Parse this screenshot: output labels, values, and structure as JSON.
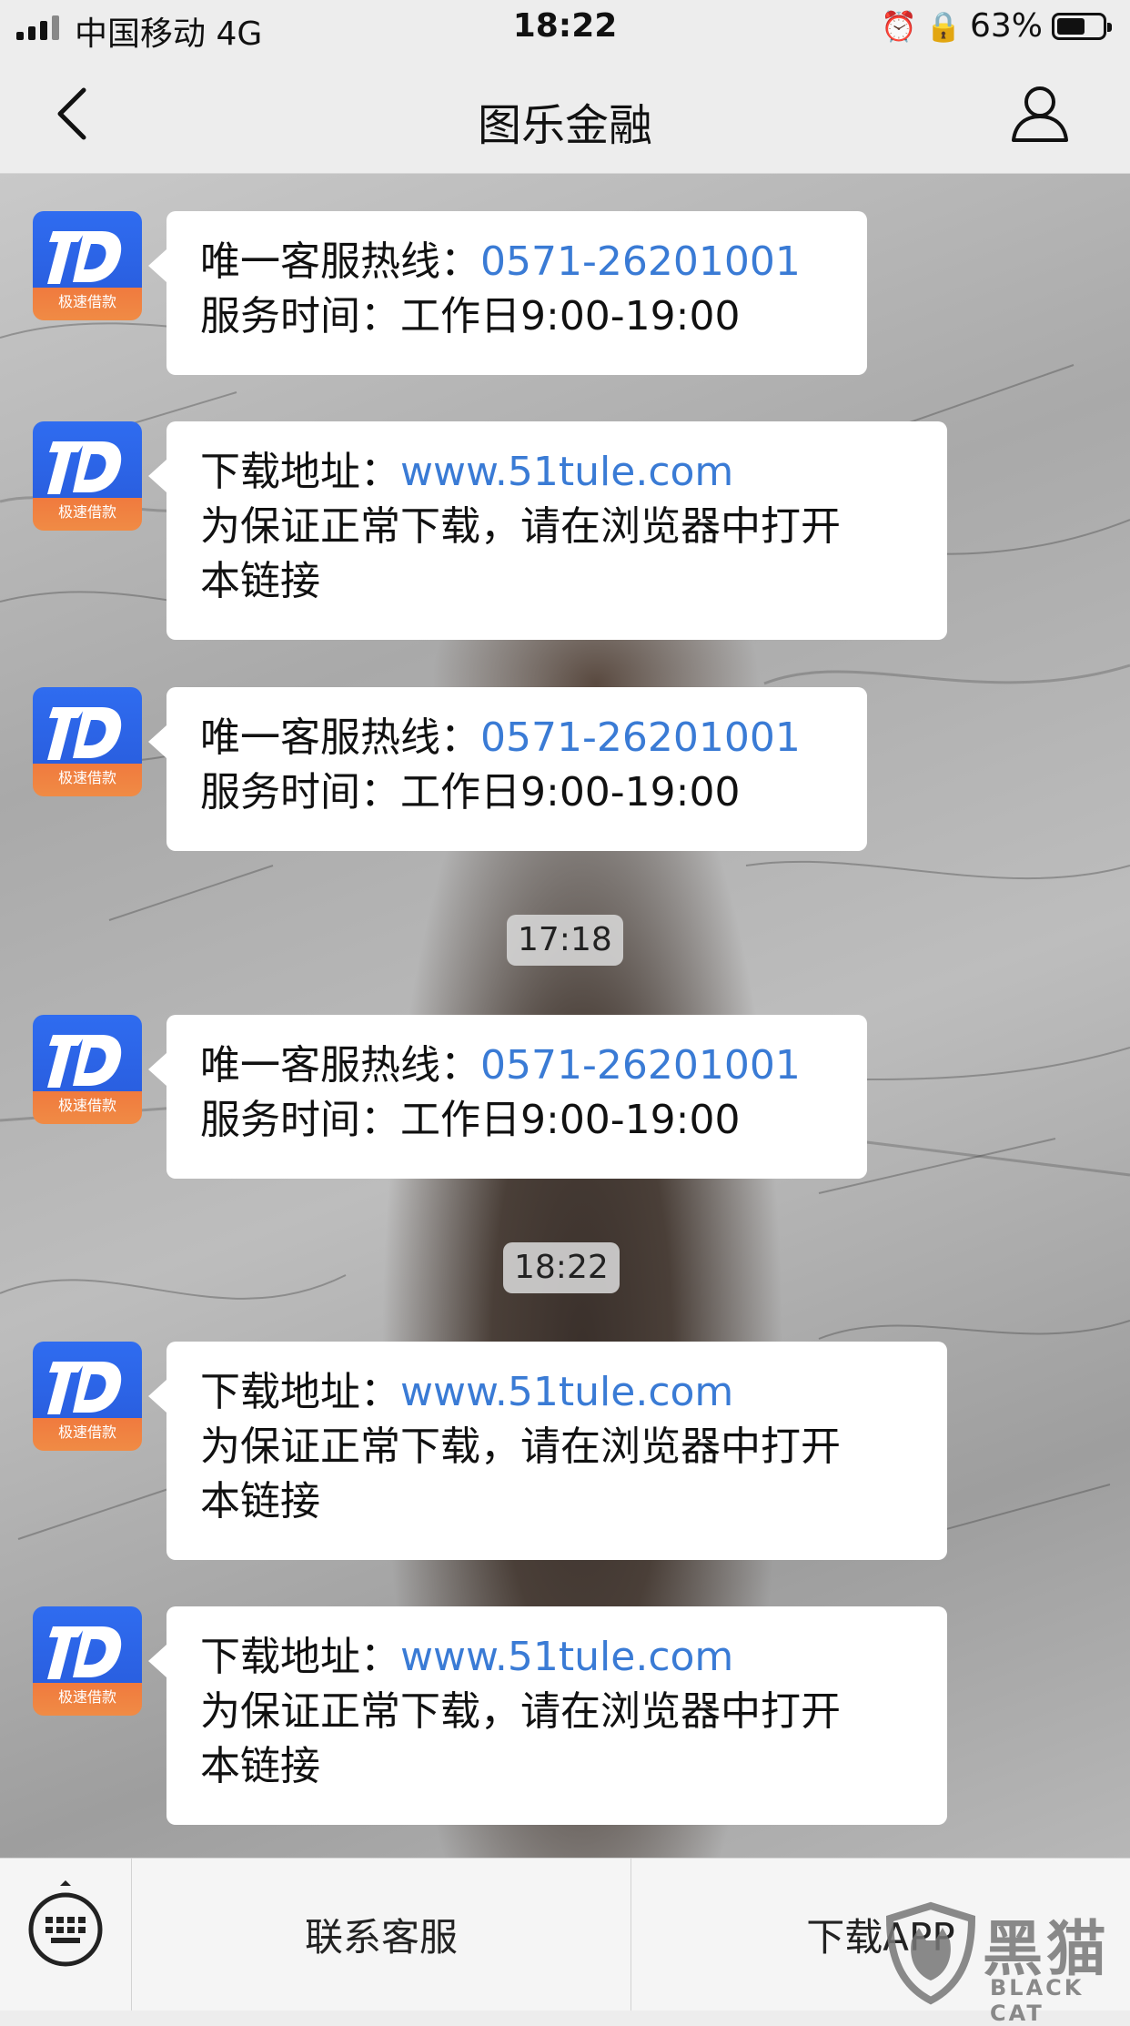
{
  "status_bar": {
    "carrier": "中国移动 4G",
    "time": "18:22",
    "battery_percent": "63%",
    "battery_level": 0.63
  },
  "nav": {
    "title": "图乐金融",
    "back_icon": "chevron-left-icon",
    "profile_icon": "person-icon"
  },
  "messages": [
    {
      "avatar_caption": "极速借款",
      "line1_label": "唯一客服热线：",
      "line1_link": "0571-26201001",
      "line2": "服务时间：工作日9:00-19:00",
      "line3": ""
    },
    {
      "avatar_caption": "极速借款",
      "line1_label": "下载地址：",
      "line1_link": "www.51tule.com",
      "line2": "为保证正常下载，请在浏览器中打开",
      "line3": "本链接"
    },
    {
      "avatar_caption": "极速借款",
      "line1_label": "唯一客服热线：",
      "line1_link": "0571-26201001",
      "line2": "服务时间：工作日9:00-19:00",
      "line3": ""
    },
    {
      "avatar_caption": "极速借款",
      "line1_label": "唯一客服热线：",
      "line1_link": "0571-26201001",
      "line2": "服务时间：工作日9:00-19:00",
      "line3": ""
    },
    {
      "avatar_caption": "极速借款",
      "line1_label": "下载地址：",
      "line1_link": "www.51tule.com",
      "line2": "为保证正常下载，请在浏览器中打开",
      "line3": "本链接"
    },
    {
      "avatar_caption": "极速借款",
      "line1_label": "下载地址：",
      "line1_link": "www.51tule.com",
      "line2": "为保证正常下载，请在浏览器中打开",
      "line3": "本链接"
    }
  ],
  "timestamps": [
    "17:18",
    "18:22"
  ],
  "bottom_bar": {
    "keyboard_icon": "keyboard-icon",
    "menu_1": "联系客服",
    "menu_2": "下载APP"
  },
  "watermark": {
    "text_cn": "黑猫",
    "text_en": "BLACK CAT"
  },
  "colors": {
    "link": "#3a7bd5",
    "avatar_blue": "#2f6cf0",
    "avatar_orange": "#f08b45"
  }
}
